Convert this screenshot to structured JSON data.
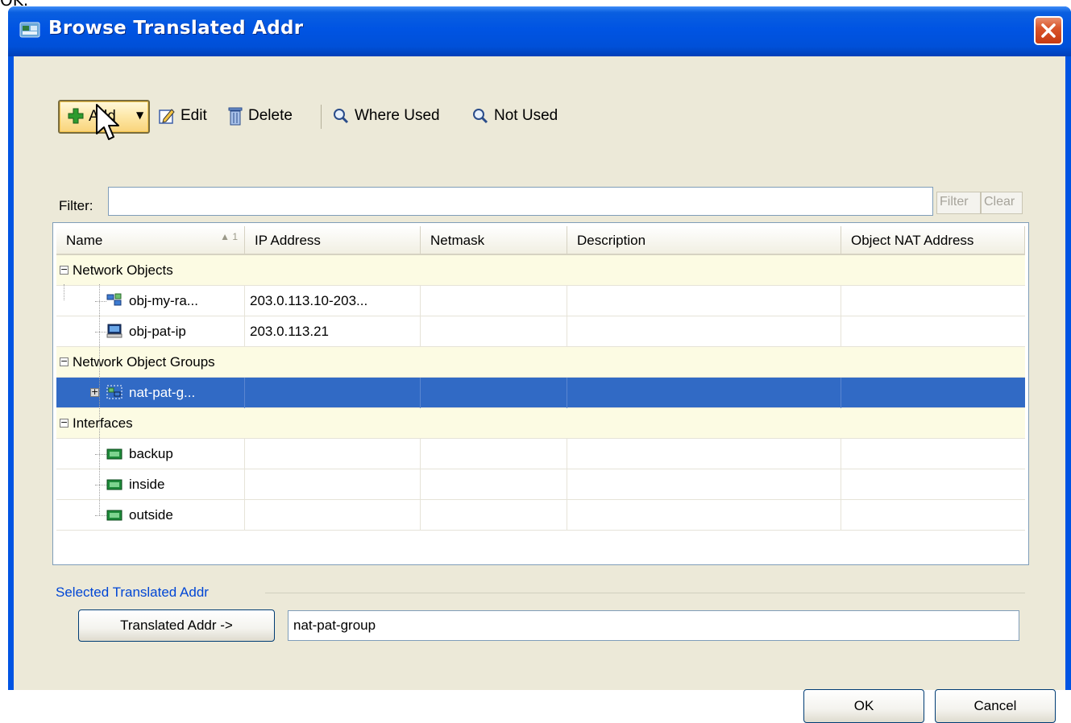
{
  "window": {
    "title": "Browse Translated Addr",
    "top_cropped_text": "OK."
  },
  "toolbar": {
    "add_label": "Add",
    "edit_label": "Edit",
    "delete_label": "Delete",
    "where_used_label": "Where Used",
    "not_used_label": "Not Used"
  },
  "filter": {
    "label": "Filter:",
    "value": "",
    "filter_button": "Filter",
    "clear_button": "Clear"
  },
  "table": {
    "columns": [
      "Name",
      "IP Address",
      "Netmask",
      "Description",
      "Object NAT Address"
    ],
    "sort_indicator": "1",
    "groups": [
      {
        "label": "Network Objects",
        "rows": [
          {
            "name": "obj-my-ra...",
            "ip": "203.0.113.10-203...",
            "netmask": "",
            "description": "",
            "nat": "",
            "icon": "network-range-icon"
          },
          {
            "name": "obj-pat-ip",
            "ip": "203.0.113.21",
            "netmask": "",
            "description": "",
            "nat": "",
            "icon": "host-icon"
          }
        ]
      },
      {
        "label": "Network Object Groups",
        "rows": [
          {
            "name": "nat-pat-g...",
            "ip": "",
            "netmask": "",
            "description": "",
            "nat": "",
            "icon": "object-group-icon",
            "selected": true
          }
        ]
      },
      {
        "label": "Interfaces",
        "rows": [
          {
            "name": "backup",
            "icon": "interface-icon"
          },
          {
            "name": "inside",
            "icon": "interface-icon"
          },
          {
            "name": "outside",
            "icon": "interface-icon"
          }
        ]
      }
    ]
  },
  "selected_section": {
    "legend": "Selected Translated Addr",
    "button_label": "Translated Addr ->",
    "value": "nat-pat-group"
  },
  "footer": {
    "ok_label": "OK",
    "cancel_label": "Cancel"
  },
  "colors": {
    "title_bar": "#0054e3",
    "selection": "#316ac5",
    "group_row": "#fcfbe3",
    "client_bg": "#ece9d8",
    "legend_text": "#0046d5"
  }
}
